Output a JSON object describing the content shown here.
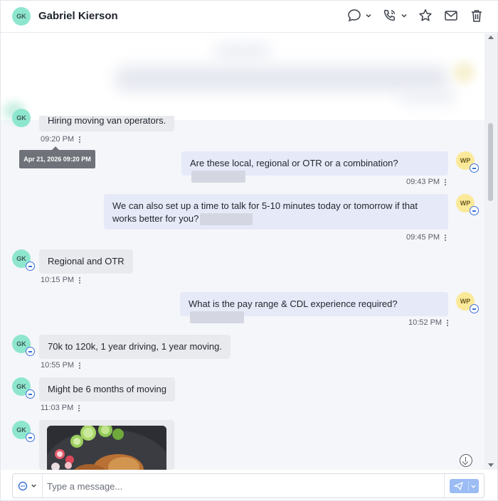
{
  "contact": {
    "initials": "GK",
    "name": "Gabriel Kierson"
  },
  "me": {
    "initials": "WP"
  },
  "header_icons": [
    "chat-bubble-icon",
    "phone-icon",
    "star-icon",
    "mail-icon",
    "trash-icon"
  ],
  "tooltip": "Apr 21, 2026 09:20 PM",
  "messages": [
    {
      "dir": "in",
      "text": "Hiring moving van operators.",
      "time": "09:20 PM"
    },
    {
      "dir": "out",
      "text": "Are these local, regional or OTR or a combination?",
      "time": "09:43 PM"
    },
    {
      "dir": "out",
      "text": "We can also set up a time to talk for 5-10 minutes today or tomorrow if that works better for you?",
      "time": "09:45 PM"
    },
    {
      "dir": "in",
      "text": "Regional and OTR",
      "time": "10:15 PM"
    },
    {
      "dir": "out",
      "text": "What is the pay range & CDL experience required?",
      "time": "10:52 PM"
    },
    {
      "dir": "in",
      "text": "70k to 120k, 1 year driving, 1 year moving.",
      "time": "10:55 PM"
    },
    {
      "dir": "in",
      "text": "Might be 6 months of moving",
      "time": "11:03 PM"
    },
    {
      "dir": "in",
      "attachment": "photo of a plate of food",
      "time": ""
    }
  ],
  "composer": {
    "placeholder": "Type a message..."
  },
  "colors": {
    "accent": "#3a6fd8",
    "send": "#9bbcf4",
    "contact_avatar": "#8ee6cf",
    "my_avatar": "#fbe99a"
  }
}
